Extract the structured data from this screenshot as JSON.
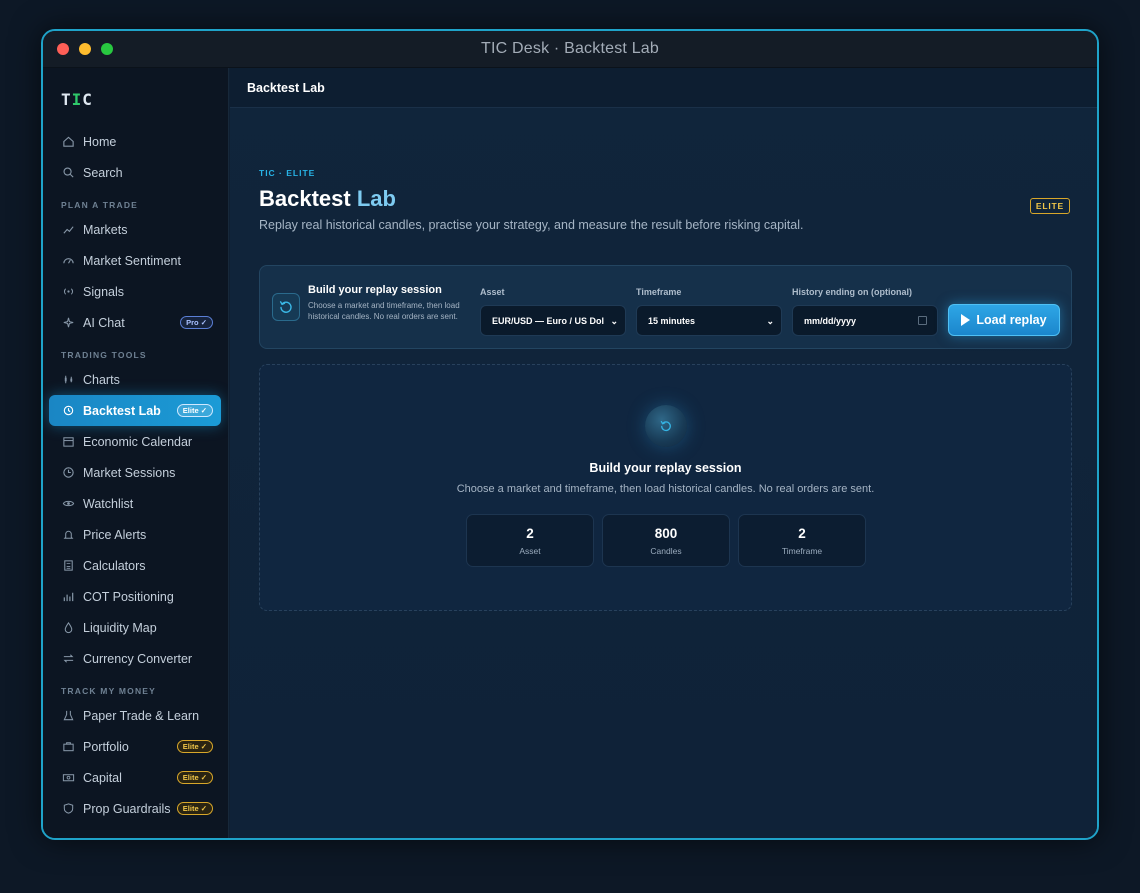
{
  "window": {
    "title": "TIC Desk  ·  Backtest Lab"
  },
  "sidebar": {
    "logo": "TIC",
    "items_top": [
      {
        "label": "Home",
        "icon": "home-icon"
      },
      {
        "label": "Search",
        "icon": "search-icon"
      }
    ],
    "sections": [
      {
        "label": "PLAN A TRADE",
        "items": [
          {
            "label": "Markets",
            "icon": "chart-line-icon"
          },
          {
            "label": "Market Sentiment",
            "icon": "gauge-icon"
          },
          {
            "label": "Signals",
            "icon": "signal-icon"
          },
          {
            "label": "AI Chat",
            "icon": "sparkle-icon",
            "badge": "Pro ✓"
          }
        ]
      },
      {
        "label": "TRADING TOOLS",
        "items": [
          {
            "label": "Charts",
            "icon": "candles-icon"
          },
          {
            "label": "Backtest Lab",
            "icon": "history-icon",
            "badge": "Elite ✓",
            "active": true
          },
          {
            "label": "Economic Calendar",
            "icon": "calendar-icon"
          },
          {
            "label": "Market Sessions",
            "icon": "clock-icon"
          },
          {
            "label": "Watchlist",
            "icon": "eye-icon"
          },
          {
            "label": "Price Alerts",
            "icon": "bell-icon"
          },
          {
            "label": "Calculators",
            "icon": "calculator-icon"
          },
          {
            "label": "COT Positioning",
            "icon": "bar-chart-icon"
          },
          {
            "label": "Liquidity Map",
            "icon": "drop-icon"
          },
          {
            "label": "Currency Converter",
            "icon": "swap-icon"
          }
        ]
      },
      {
        "label": "TRACK MY MONEY",
        "items": [
          {
            "label": "Paper Trade & Learn",
            "icon": "flask-icon"
          },
          {
            "label": "Portfolio",
            "icon": "briefcase-icon",
            "badge": "Elite ✓"
          },
          {
            "label": "Capital",
            "icon": "cash-icon",
            "badge": "Elite ✓"
          },
          {
            "label": "Prop Guardrails",
            "icon": "shield-icon",
            "badge": "Elite ✓"
          }
        ]
      }
    ]
  },
  "topbar": {
    "title": "Backtest Lab"
  },
  "page": {
    "eyebrow": "TIC · ELITE",
    "title_main": "Backtest",
    "title_accent": "Lab",
    "subtitle": "Replay real historical candles, practise your strategy, and measure the result before risking capital.",
    "tag": "ELITE"
  },
  "session": {
    "title": "Build your replay session",
    "description": "Choose a market and timeframe, then load historical candles. No real orders are sent.",
    "asset_label": "Asset",
    "asset_value": "EUR/USD — Euro / US Dol",
    "timeframe_label": "Timeframe",
    "timeframe_value": "15 minutes",
    "history_label": "History ending on (optional)",
    "history_placeholder": "mm/dd/yyyy",
    "load_button": "Load replay"
  },
  "empty": {
    "title": "Build your replay session",
    "description": "Choose a market and timeframe, then load historical candles. No real orders are sent.",
    "stats": [
      {
        "value": "2",
        "label": "Asset"
      },
      {
        "value": "800",
        "label": "Candles"
      },
      {
        "value": "2",
        "label": "Timeframe"
      }
    ]
  }
}
